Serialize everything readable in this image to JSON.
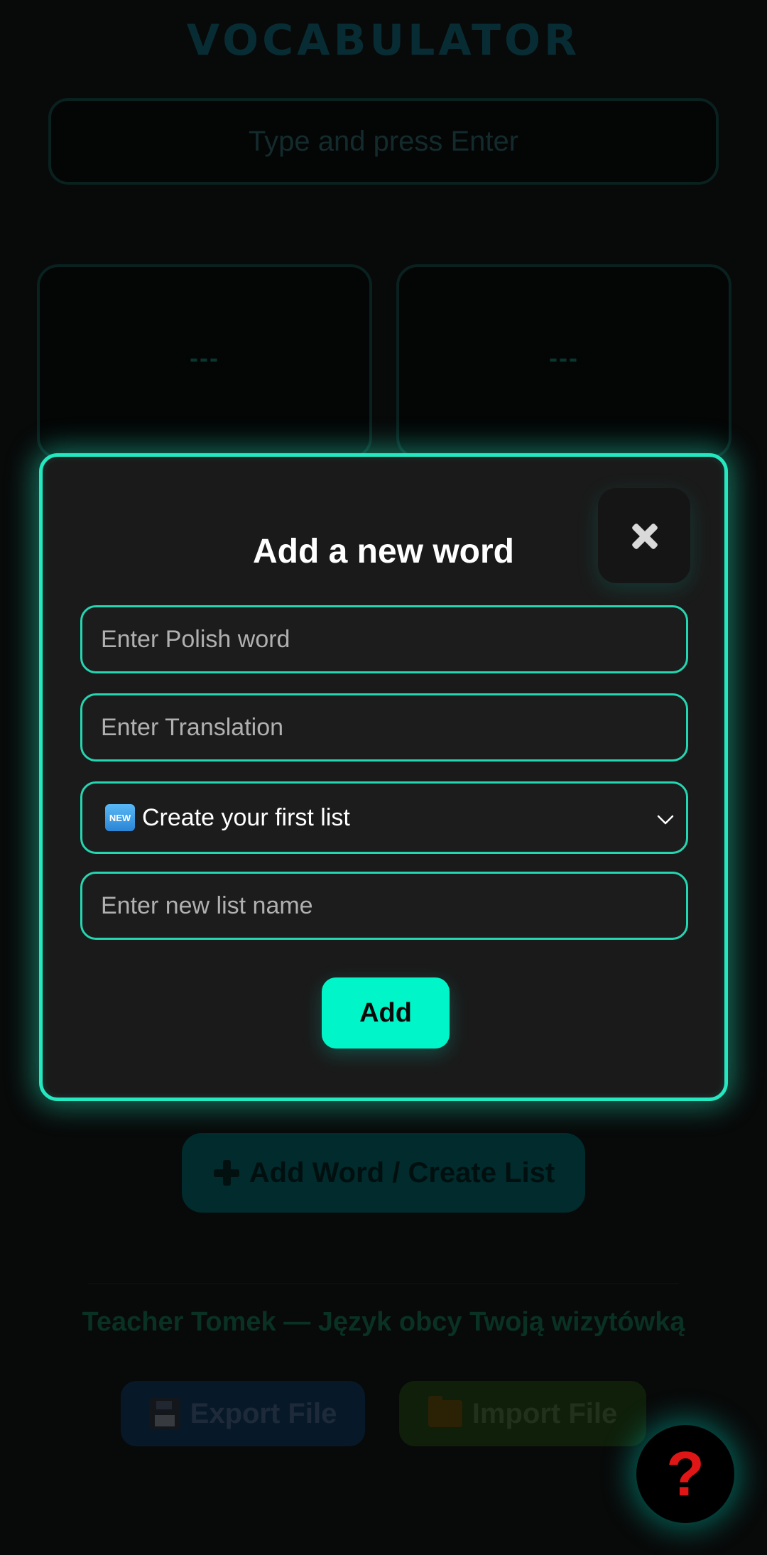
{
  "app": {
    "title": "VOCABULATOR",
    "input_placeholder": "Type and press Enter",
    "cards": [
      {
        "value": "---"
      },
      {
        "value": "---"
      }
    ],
    "add_word_button_label": "Add Word / Create List",
    "footer_text": "Teacher Tomek — Język obcy Twoją wizytówką",
    "export_button_label": "Export File",
    "import_button_label": "Import File",
    "help_button_label": "?"
  },
  "modal": {
    "title": "Add a new word",
    "close_symbol": "✖",
    "polish_placeholder": "Enter Polish word",
    "translation_placeholder": "Enter Translation",
    "list_select": {
      "badge": "NEW",
      "selected": "Create your first list"
    },
    "new_list_placeholder": "Enter new list name",
    "add_button_label": "Add"
  },
  "colors": {
    "accent": "#24e8c0",
    "add_button": "#00f5c8",
    "modal_background": "#1a1a1a",
    "help_icon": "#e01616"
  },
  "icons": {
    "close": "close-icon",
    "plus": "plus-icon",
    "export": "floppy-disk-icon",
    "import": "folder-icon",
    "help": "question-mark-icon",
    "select": "chevron-down-icon",
    "badge": "new-badge-icon"
  }
}
